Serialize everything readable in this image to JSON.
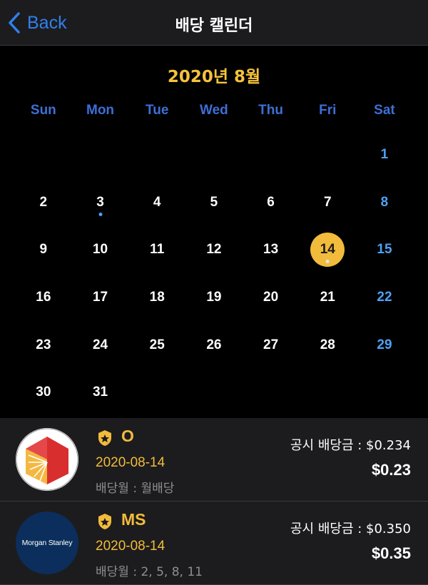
{
  "nav": {
    "back_label": "Back",
    "title": "배당 캘린더"
  },
  "calendar": {
    "month_title": "2020년 8월",
    "weekdays": [
      "Sun",
      "Mon",
      "Tue",
      "Wed",
      "Thu",
      "Fri",
      "Sat"
    ],
    "weeks": [
      [
        "",
        "",
        "",
        "",
        "",
        "",
        "1"
      ],
      [
        "2",
        "3",
        "4",
        "5",
        "6",
        "7",
        "8"
      ],
      [
        "9",
        "10",
        "11",
        "12",
        "13",
        "14",
        "15"
      ],
      [
        "16",
        "17",
        "18",
        "19",
        "20",
        "21",
        "22"
      ],
      [
        "23",
        "24",
        "25",
        "26",
        "27",
        "28",
        "29"
      ],
      [
        "30",
        "31",
        "",
        "",
        "",
        "",
        ""
      ]
    ],
    "selected_day": "14",
    "blue_dot_days": [
      "3"
    ],
    "white_dot_days": [
      "14"
    ],
    "colors": {
      "accent_gold": "#f2bb3b",
      "weekday_blue": "#3d6fd6",
      "saturday_blue": "#4ea1f3"
    }
  },
  "dividends": [
    {
      "logo": "realty-income-logo",
      "ticker": "O",
      "date": "2020-08-14",
      "month_info": "배당월 : 월배당",
      "announced": "공시 배당금 : $0.234",
      "amount": "$0.23"
    },
    {
      "logo": "morgan-stanley-logo",
      "logo_text": "Morgan Stanley",
      "ticker": "MS",
      "date": "2020-08-14",
      "month_info": "배당월 : 2, 5, 8, 11",
      "announced": "공시 배당금 : $0.350",
      "amount": "$0.35"
    }
  ]
}
